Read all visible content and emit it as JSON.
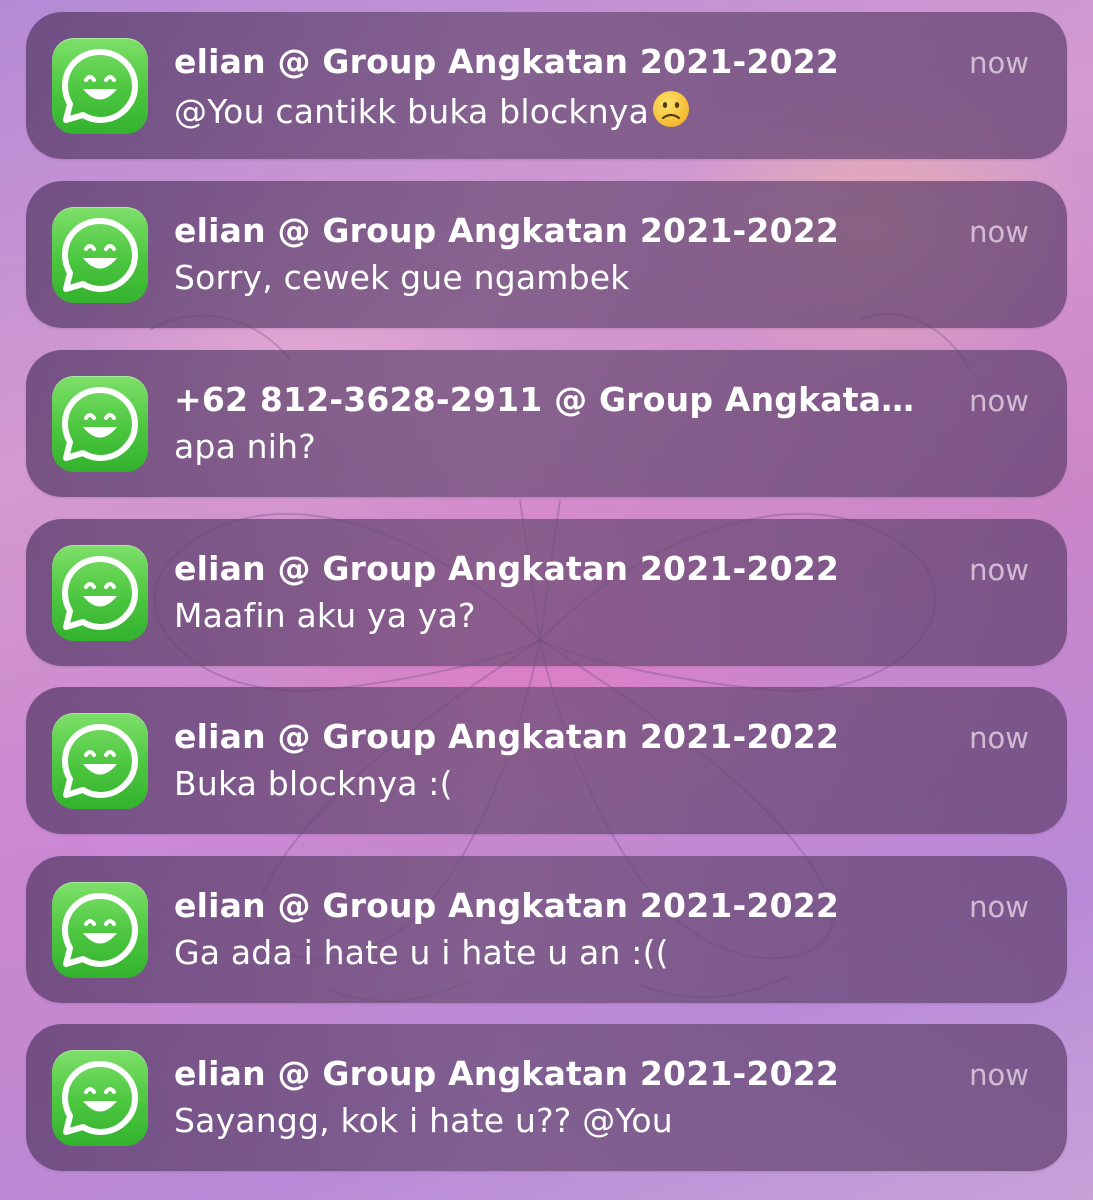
{
  "notifications": [
    {
      "icon": "whatsapp-app-icon",
      "title": "elian  @ Group Angkatan 2021-2022",
      "time": "now",
      "message": "@You cantikk buka blocknya",
      "emoji": "slightly-frowning-face"
    },
    {
      "icon": "whatsapp-app-icon",
      "title": "elian  @ Group Angkatan 2021-2022",
      "time": "now",
      "message": "Sorry, cewek gue ngambek"
    },
    {
      "icon": "whatsapp-app-icon",
      "title": "+62 812-3628-2911 @ Group Angkatan...",
      "time": "now",
      "message": "apa nih?"
    },
    {
      "icon": "whatsapp-app-icon",
      "title": "elian  @ Group Angkatan 2021-2022",
      "time": "now",
      "message": "Maafin aku ya ya?"
    },
    {
      "icon": "whatsapp-app-icon",
      "title": "elian  @ Group Angkatan 2021-2022",
      "time": "now",
      "message": "Buka blocknya :("
    },
    {
      "icon": "whatsapp-app-icon",
      "title": "elian  @ Group Angkatan 2021-2022",
      "time": "now",
      "message": "Ga ada i hate u i hate u an :(("
    },
    {
      "icon": "whatsapp-app-icon",
      "title": "elian  @ Group Angkatan 2021-2022",
      "time": "now",
      "message": "Sayangg, kok i hate u?? @You"
    }
  ],
  "colors": {
    "icon_green": "#4cc63f",
    "banner": "#6a4a78",
    "title_text": "#ffffff",
    "time_text": "#e1cde1"
  }
}
